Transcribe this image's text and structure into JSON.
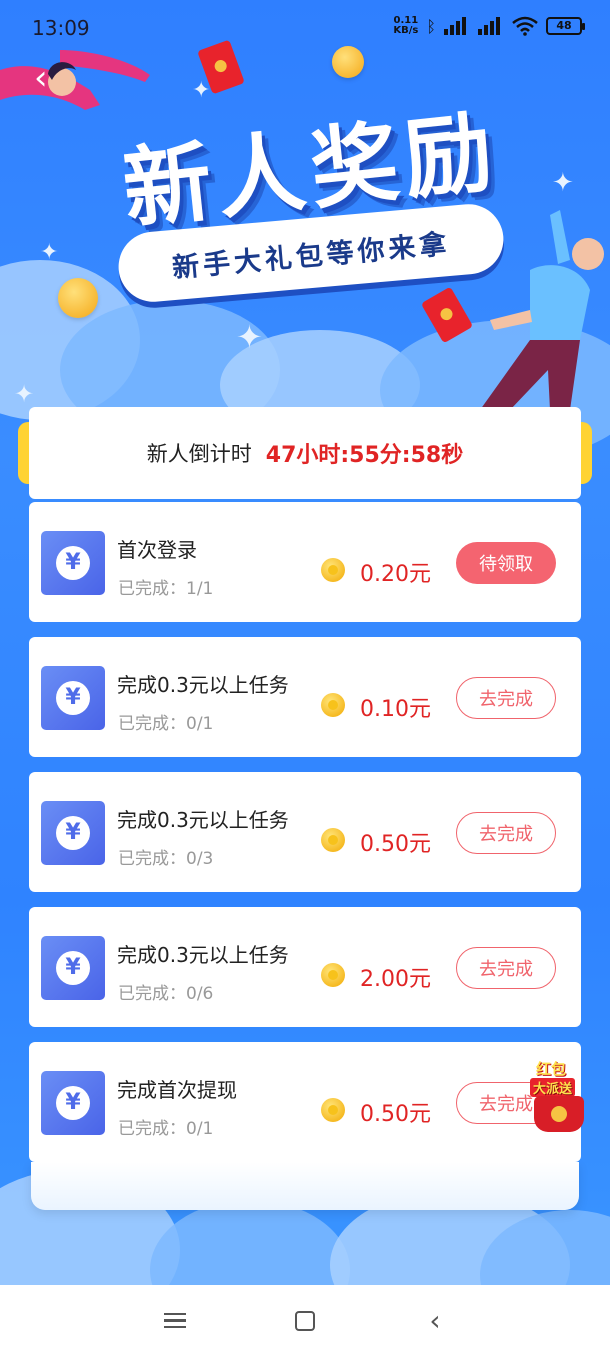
{
  "status_bar": {
    "time": "13:09",
    "net_speed_value": "0.11",
    "net_speed_unit": "KB/s",
    "battery": "48"
  },
  "banner": {
    "title": "新人奖励",
    "subtitle": "新手大礼包等你来拿"
  },
  "countdown": {
    "label": "新人倒计时",
    "value": "47小时:55分:58秒"
  },
  "tasks": [
    {
      "title": "首次登录",
      "progress": "已完成：1/1",
      "reward": "0.20元",
      "button": "待领取",
      "button_style": "filled"
    },
    {
      "title": "完成0.3元以上任务",
      "progress": "已完成：0/1",
      "reward": "0.10元",
      "button": "去完成",
      "button_style": "outline"
    },
    {
      "title": "完成0.3元以上任务",
      "progress": "已完成：0/3",
      "reward": "0.50元",
      "button": "去完成",
      "button_style": "outline"
    },
    {
      "title": "完成0.3元以上任务",
      "progress": "已完成：0/6",
      "reward": "2.00元",
      "button": "去完成",
      "button_style": "outline"
    },
    {
      "title": "完成首次提现",
      "progress": "已完成：0/1",
      "reward": "0.50元",
      "button": "去完成",
      "button_style": "outline"
    }
  ],
  "hongbao_badge": {
    "top": "红包",
    "sub": "大派送"
  },
  "icons": {
    "task": "yen-icon",
    "reward": "coin-icon",
    "back": "chevron-left-icon"
  },
  "colors": {
    "background": "#2f7fff",
    "accent_red": "#e02424",
    "button_pink": "#f46470",
    "icon_blue": "#4f6ce9"
  }
}
